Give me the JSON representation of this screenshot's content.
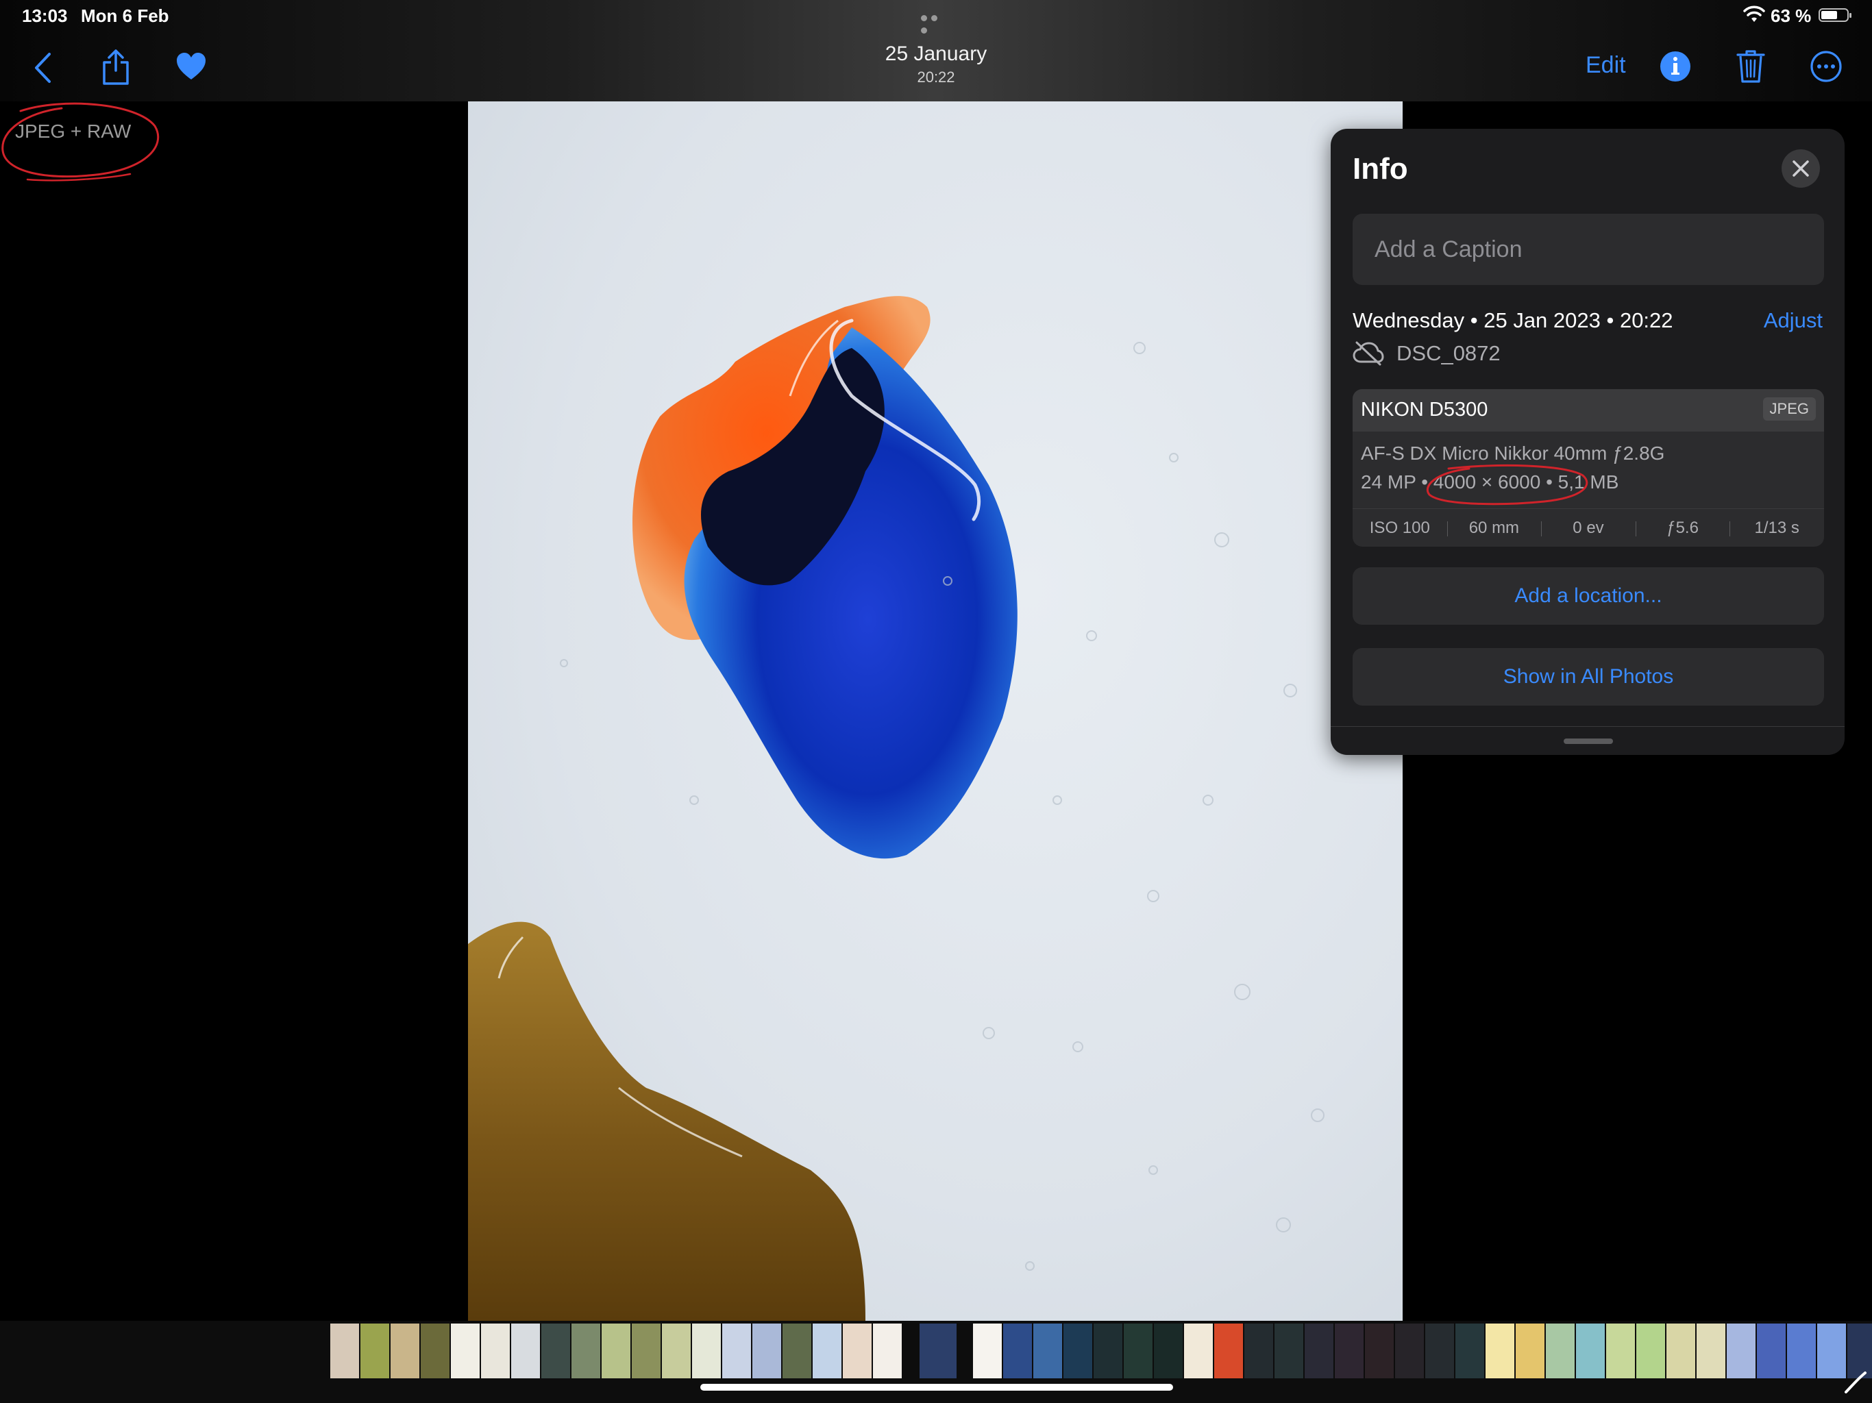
{
  "status_bar": {
    "time": "13:03",
    "date": "Mon 6 Feb",
    "battery_percent": "63 %",
    "battery_level": 0.63,
    "wifi_icon": "wifi-icon"
  },
  "nav": {
    "title_date": "25 January",
    "title_time": "20:22",
    "edit_label": "Edit",
    "icons": [
      "back-chevron-icon",
      "share-icon",
      "heart-icon",
      "info-icon",
      "trash-icon",
      "more-icon"
    ],
    "accent_color": "#3a8bff"
  },
  "overlay": {
    "format_label": "JPEG + RAW",
    "annotation_color": "#d0232a"
  },
  "info_panel": {
    "title": "Info",
    "caption_placeholder": "Add a Caption",
    "datetime": "Wednesday • 25 Jan 2023 • 20:22",
    "adjust_label": "Adjust",
    "filename": "DSC_0872",
    "camera": {
      "name": "NIKON D5300",
      "format_badge": "JPEG",
      "lens": "AF-S DX Micro Nikkor 40mm ƒ2.8G",
      "megapixels": "24 MP",
      "dimensions": "4000 × 6000",
      "file_size": "5,1 MB",
      "exif": [
        "ISO 100",
        "60 mm",
        "0 ev",
        "ƒ5.6",
        "1/13 s"
      ]
    },
    "add_location_label": "Add a location...",
    "show_all_label": "Show in All Photos"
  },
  "filmstrip": {
    "thumbnail_colors": [
      "#d7c9b8",
      "#9aa44e",
      "#c9b58a",
      "#6b6a3a",
      "#f1efe6",
      "#e9e6dc",
      "#d8dce0",
      "#3d4c48",
      "#7b8a6b",
      "#b7c28a",
      "#8b915c",
      "#c7cc9c",
      "#e5e8d8",
      "#c9d3e6",
      "#aab9d8",
      "#5f6b4b",
      "#c2d3e8",
      "#e9d8c8",
      "#f3efe9",
      "#2c3f6a",
      "#f6f3ee",
      "#2d4c8a",
      "#3c6aa5",
      "#1d3b55",
      "#1f2f33",
      "#243a34",
      "#1a2a28",
      "#f1e9d9",
      "#d84a2a",
      "#242c30",
      "#263234",
      "#2a2a36",
      "#2e2631",
      "#2c2226",
      "#272429",
      "#262c30",
      "#26383c",
      "#f3e6a6",
      "#e4c56c",
      "#a8c8a4",
      "#86c0c9",
      "#c7d89a",
      "#b3d48c",
      "#d9d6a6",
      "#e0dcb8",
      "#a6b7e0",
      "#4a64b8",
      "#5a7cd0",
      "#7fa2e4",
      "#283658",
      "#2a3244"
    ],
    "selected_index": 19
  }
}
